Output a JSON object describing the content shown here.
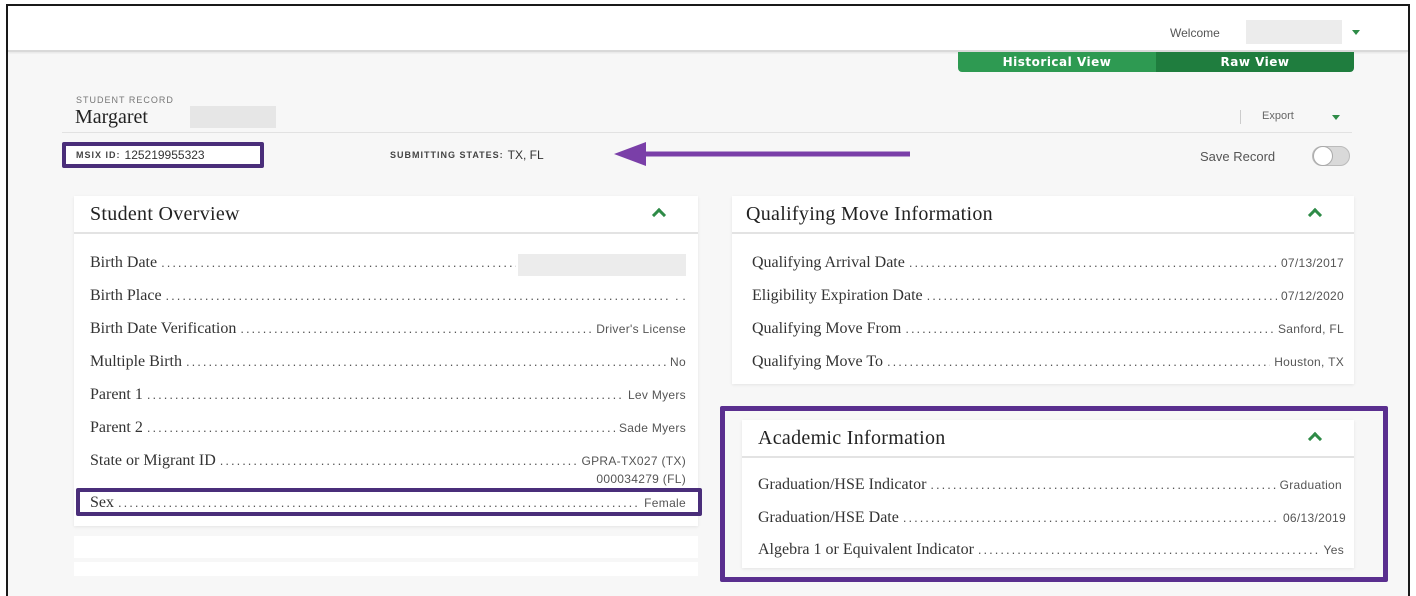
{
  "header": {
    "welcome_label": "Welcome",
    "user_name": ""
  },
  "view_toggle": {
    "historical_label": "Historical View",
    "raw_label": "Raw View"
  },
  "record": {
    "section_label": "STUDENT RECORD",
    "first_name": "Margaret",
    "msix_label": "MSIX ID:",
    "msix_id": "125219955323",
    "submitting_states_label": "SUBMITTING STATES:",
    "submitting_states": "TX, FL",
    "export_label": "Export",
    "save_record_label": "Save Record",
    "save_record_on": false
  },
  "student_overview": {
    "title": "Student Overview",
    "rows": [
      {
        "label": "Birth Date",
        "value": ""
      },
      {
        "label": "Birth Place",
        "value": ". ."
      },
      {
        "label": "Birth Date Verification",
        "value": "Driver's License"
      },
      {
        "label": "Multiple Birth",
        "value": "No"
      },
      {
        "label": "Parent 1",
        "value": "Lev Myers"
      },
      {
        "label": "Parent 2",
        "value": "Sade Myers"
      },
      {
        "label": "State or Migrant ID",
        "value": "GPRA-TX027 (TX)",
        "value2": "000034279 (FL)"
      },
      {
        "label": "Sex",
        "value": "Female"
      }
    ]
  },
  "qualifying_move": {
    "title": "Qualifying Move Information",
    "rows": [
      {
        "label": "Qualifying Arrival Date",
        "value": "07/13/2017"
      },
      {
        "label": "Eligibility Expiration Date",
        "value": "07/12/2020"
      },
      {
        "label": "Qualifying Move From",
        "value": "Sanford, FL"
      },
      {
        "label": "Qualifying Move To",
        "value": "Houston, TX"
      }
    ]
  },
  "academic_info": {
    "title": "Academic Information",
    "rows": [
      {
        "label": "Graduation/HSE Indicator",
        "value": "Graduation"
      },
      {
        "label": "Graduation/HSE Date",
        "value": "06/13/2019"
      },
      {
        "label": "Algebra 1 or Equivalent Indicator",
        "value": "Yes"
      }
    ]
  },
  "colors": {
    "accent_green": "#2e8b47",
    "toggle_historical": "#2e9a52",
    "toggle_raw": "#1f7d3e",
    "highlight_purple": "#4a2e7a",
    "arrow_purple": "#7a3fa8"
  }
}
